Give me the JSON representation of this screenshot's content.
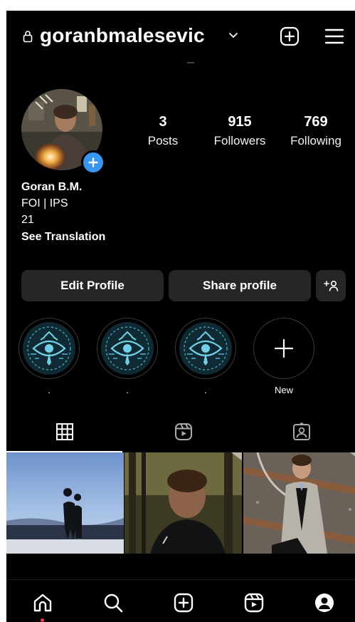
{
  "header": {
    "username": "goranbmalesevic"
  },
  "stats": {
    "posts": {
      "value": "3",
      "label": "Posts"
    },
    "followers": {
      "value": "915",
      "label": "Followers"
    },
    "following": {
      "value": "769",
      "label": "Following"
    }
  },
  "bio": {
    "name": "Goran B.M.",
    "line1": "FOI | IPS",
    "line2": "21",
    "translate": "See Translation"
  },
  "buttons": {
    "edit_profile": "Edit Profile",
    "share_profile": "Share profile"
  },
  "highlights": [
    {
      "label": "."
    },
    {
      "label": "."
    },
    {
      "label": "."
    },
    {
      "label": "New"
    }
  ],
  "tabs": {
    "active": "grid"
  },
  "icons": {
    "lock": "lock-icon",
    "chevron": "chevron-down-icon",
    "create": "plus-square-icon",
    "menu": "hamburger-menu-icon",
    "grid": "grid-icon",
    "reels": "reels-icon",
    "tagged": "tagged-person-icon",
    "home": "home-icon",
    "search": "search-icon",
    "profile": "profile-icon"
  },
  "colors": {
    "background": "#000000",
    "button": "#262626",
    "accent_blue": "#3797f0",
    "highlight_teal": "#6fd0e8",
    "notification": "#ff3040"
  }
}
